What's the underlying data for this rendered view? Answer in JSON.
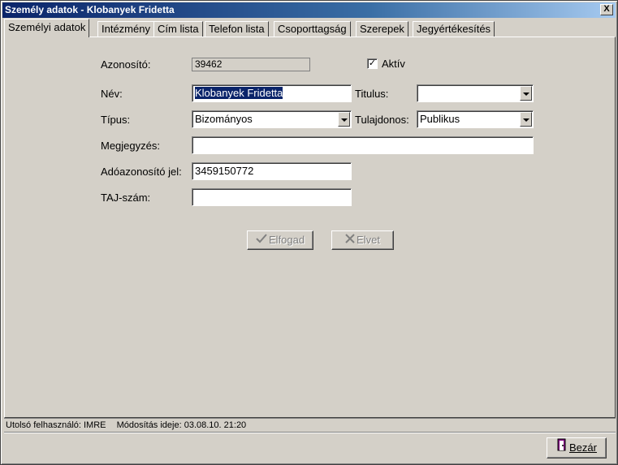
{
  "window": {
    "title": "Személy adatok - Klobanyek Fridetta",
    "close_label": "X"
  },
  "tabs": [
    {
      "label": "Személyi adatok",
      "active": true
    },
    {
      "label": "Intézmény"
    },
    {
      "label": "Cím lista"
    },
    {
      "label": "Telefon lista"
    },
    {
      "label": "Csoporttagság"
    },
    {
      "label": "Szerepek"
    },
    {
      "label": "Jegyértékesítés"
    }
  ],
  "form": {
    "azonosito": {
      "label": "Azonosító:",
      "value": "39462"
    },
    "aktiv": {
      "label": "Aktív",
      "checked": true,
      "mark": "✓"
    },
    "nev": {
      "label": "Név:",
      "value": "Klobanyek Fridetta"
    },
    "titulus": {
      "label": "Titulus:",
      "value": ""
    },
    "tipus": {
      "label": "Típus:",
      "value": "Bizományos"
    },
    "tulajdonos": {
      "label": "Tulajdonos:",
      "value": "Publikus"
    },
    "megjegyzes": {
      "label": "Megjegyzés:",
      "value": ""
    },
    "adoazonosito": {
      "label": "Adóazonosító jel:",
      "value": "3459150772"
    },
    "taj": {
      "label": "TAJ-szám:",
      "value": ""
    }
  },
  "actions": {
    "elfogad": {
      "label": "Elfogad",
      "icon": "checkmark-icon",
      "enabled": false
    },
    "elvet": {
      "label": "Elvet",
      "icon": "x-icon",
      "enabled": false
    }
  },
  "status": {
    "last_user": "Utolsó felhasználó: IMRE",
    "modified": "Módosítás ideje: 03.08.10. 21:20"
  },
  "footer": {
    "close_label": "Bezár",
    "close_icon": "door-exit-icon"
  }
}
